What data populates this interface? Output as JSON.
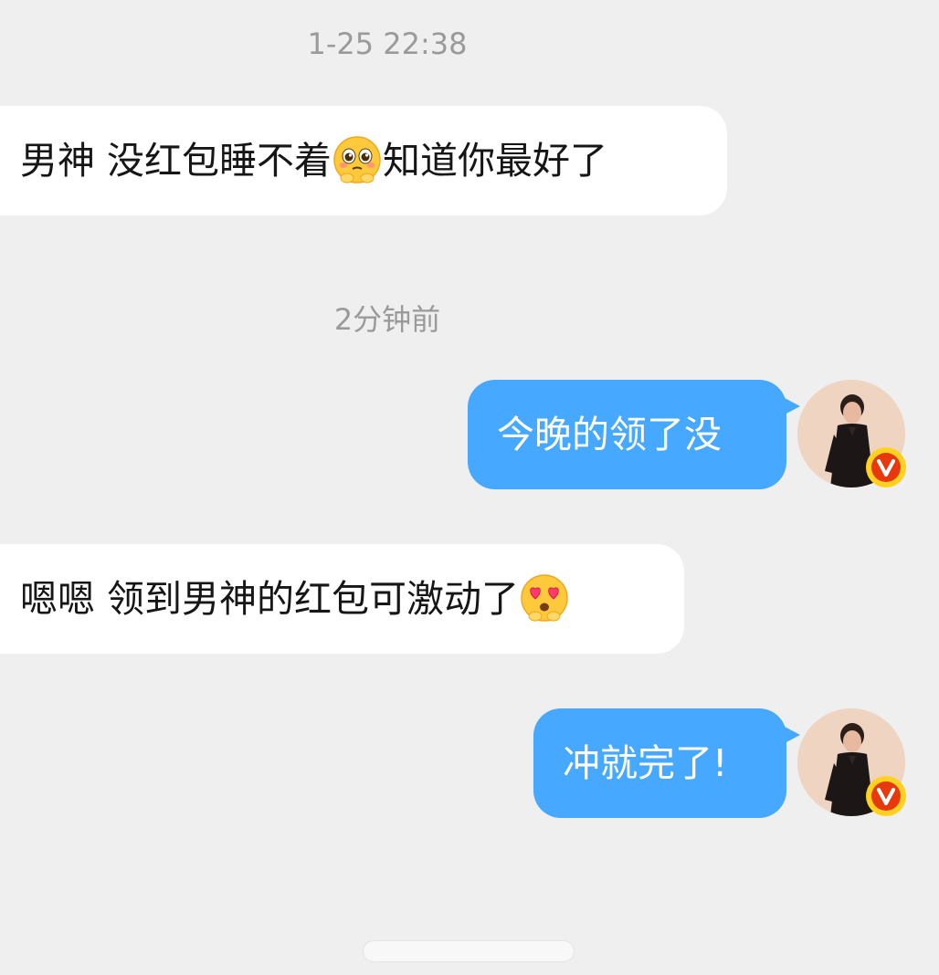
{
  "conversation": {
    "timestamps": [
      "1-25 22:38",
      "2分钟前"
    ],
    "messages": [
      {
        "side": "incoming",
        "text_before": "男神 没红包睡不着",
        "emoji": "pleading-face-emoji",
        "text_after": "知道你最好了"
      },
      {
        "side": "outgoing",
        "text": "今晚的领了没"
      },
      {
        "side": "incoming",
        "text_before": "嗯嗯 领到男神的红包可激动了",
        "emoji": "heart-eyes-emoji",
        "text_after": ""
      },
      {
        "side": "outgoing",
        "text": "冲就完了!"
      }
    ]
  },
  "avatar": {
    "badge_letter": "V",
    "badge_color": "#e8390e",
    "badge_ring": "#ffd21f"
  },
  "colors": {
    "background": "#efefef",
    "incoming_bubble": "#ffffff",
    "outgoing_bubble": "#47a8ff",
    "timestamp_text": "#9a9a9a"
  }
}
